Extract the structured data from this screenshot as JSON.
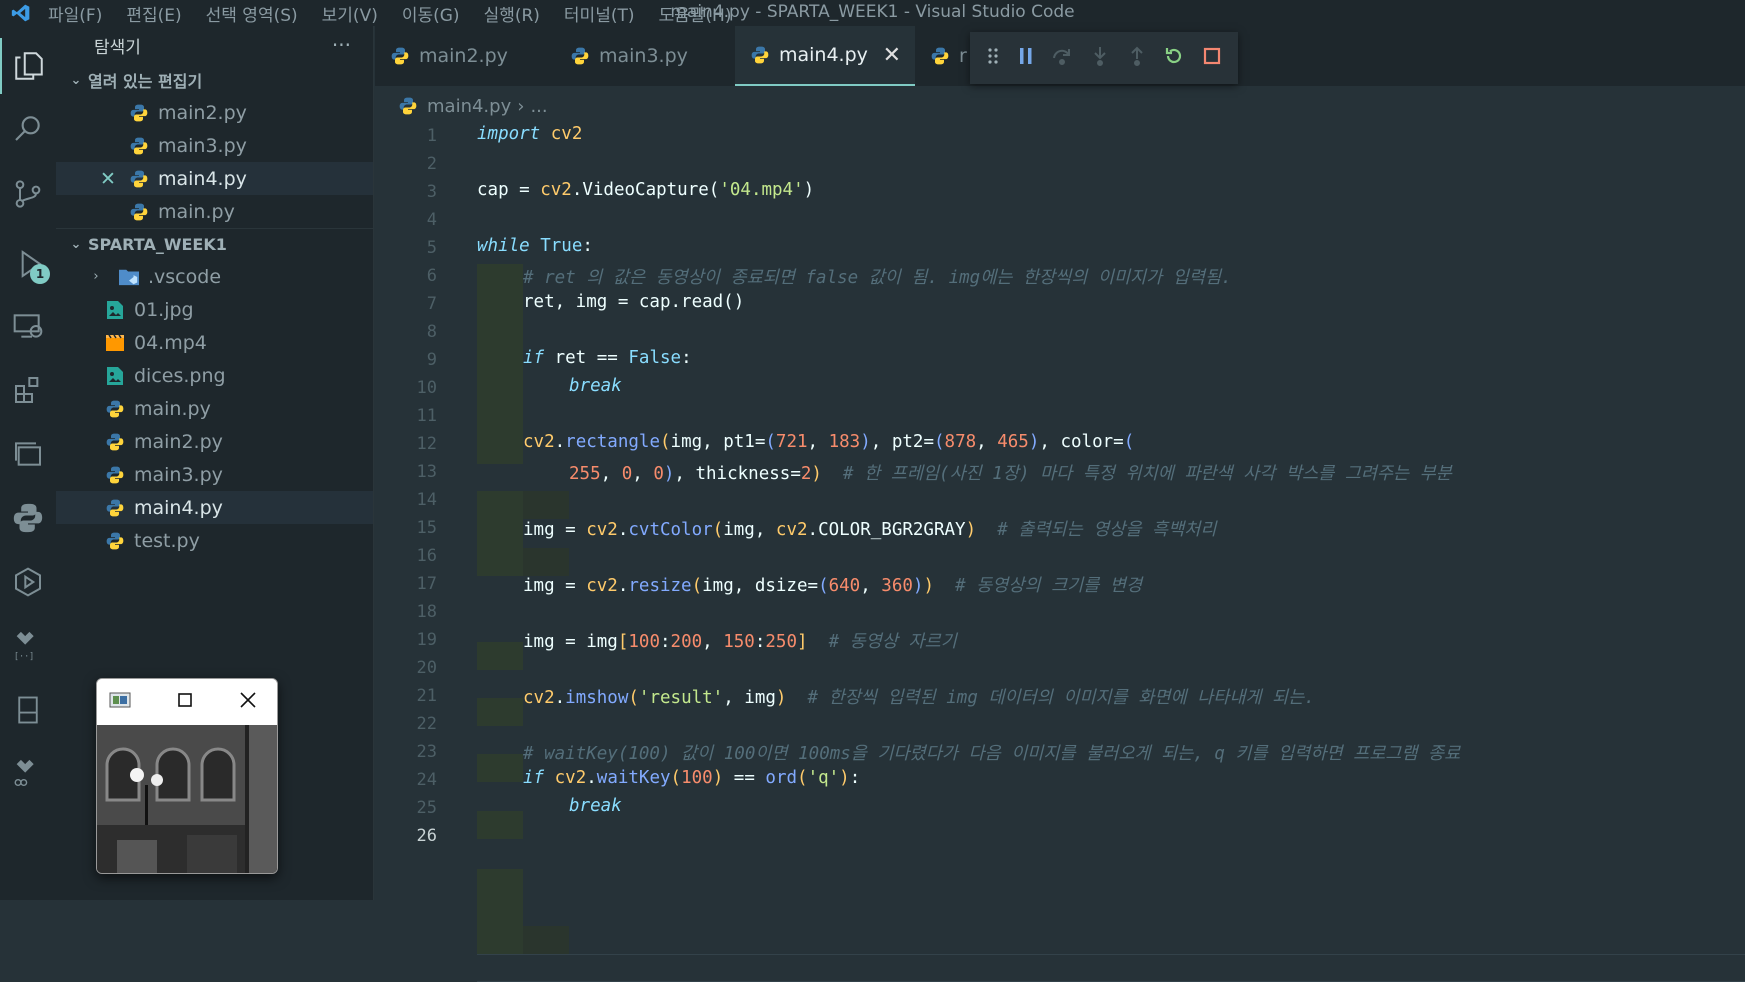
{
  "menu": [
    "파일(F)",
    "편집(E)",
    "선택 영역(S)",
    "보기(V)",
    "이동(G)",
    "실행(R)",
    "터미널(T)",
    "도움말(H)"
  ],
  "window_title": "main4.py - SPARTA_WEEK1 - Visual Studio Code",
  "activity_badge": "1",
  "sidebar": {
    "title": "탐색기",
    "more": "···",
    "open_editors_title": "열려 있는 편집기",
    "open_editors": [
      {
        "name": "main2.py"
      },
      {
        "name": "main3.py"
      },
      {
        "name": "main4.py",
        "close": "✕"
      },
      {
        "name": "main.py"
      }
    ],
    "workspace_title": "SPARTA_WEEK1",
    "files": [
      {
        "name": ".vscode",
        "kind": "folder"
      },
      {
        "name": "01.jpg",
        "kind": "image"
      },
      {
        "name": "04.mp4",
        "kind": "video"
      },
      {
        "name": "dices.png",
        "kind": "image"
      },
      {
        "name": "main.py",
        "kind": "py"
      },
      {
        "name": "main2.py",
        "kind": "py"
      },
      {
        "name": "main3.py",
        "kind": "py"
      },
      {
        "name": "main4.py",
        "kind": "py"
      },
      {
        "name": "test.py",
        "kind": "py"
      }
    ]
  },
  "tabs": [
    {
      "label": "main2.py"
    },
    {
      "label": "main3.py"
    },
    {
      "label": "main4.py",
      "close": "✕"
    },
    {
      "label": "r"
    }
  ],
  "breadcrumb": {
    "file": "main4.py",
    "sep": "›",
    "rest": "..."
  },
  "code_lines": [
    "1",
    "2",
    "3",
    "4",
    "5",
    "6",
    "7",
    "8",
    "9",
    "10",
    "11",
    "12",
    "13",
    "14",
    "15",
    "16",
    "17",
    "18",
    "19",
    "20",
    "21",
    "22",
    "23",
    "24",
    "25",
    "26"
  ],
  "code": {
    "l1_kw": "import",
    "l1_mod": "cv2",
    "l3_a": "cap = ",
    "l3_b": "cv2",
    "l3_c": ".VideoCapture(",
    "l3_s": "'04.mp4'",
    "l3_d": ")",
    "l5_kw": "while",
    "l5_b": "True",
    "l6_c": "# ret 의 값은 동영상이 종료되면 false 값이 됨. img에는 한장씩의 이미지가 입력됨.",
    "l7_a": "ret, img = cap.read()",
    "l9_kw": "if",
    "l9_a": " ret == ",
    "l9_b": "False",
    "l10_kw": "break",
    "l12_a": "cv2",
    "l12_f": "rectangle",
    "l12_b": "img",
    "l12_pt1": "pt1",
    "l12_n1": "721",
    "l12_n2": "183",
    "l12_pt2": "pt2",
    "l12_n3": "878",
    "l12_n4": "465",
    "l12_col": "color",
    "l13_n1": "255",
    "l13_n2": "0",
    "l13_n3": "0",
    "l13_th": "thickness",
    "l13_n4": "2",
    "l13_c": "# 한 프레임(사진 1장) 마다 특정 위치에 파란색 사각 박스를 그려주는 부분",
    "l15_a": "img = ",
    "l15_m": "cv2",
    "l15_f": "cvtColor",
    "l15_b": "img",
    "l15_m2": "cv2",
    "l15_k": "COLOR_BGR2GRAY",
    "l15_c": "# 출력되는 영상을 흑백처리",
    "l17_a": "img = ",
    "l17_m": "cv2",
    "l17_f": "resize",
    "l17_b": "img",
    "l17_d": "dsize",
    "l17_n1": "640",
    "l17_n2": "360",
    "l17_c": "# 동영상의 크기를 변경",
    "l19_a": "img = img",
    "l19_n1": "100",
    "l19_n2": "200",
    "l19_n3": "150",
    "l19_n4": "250",
    "l19_c": "# 동영상 자르기",
    "l21_m": "cv2",
    "l21_f": "imshow",
    "l21_s": "'result'",
    "l21_b": "img",
    "l21_c": "# 한장씩 입력된 img 데이터의 이미지를 화면에 나타내게 되는.",
    "l23_c": "# waitKey(100) 값이 100이면 100ms을 기다렸다가 다음 이미지를 불러오게 되는, q 키를 입력하면 프로그램 종료",
    "l24_kw": "if",
    "l24_m": "cv2",
    "l24_f": "waitKey",
    "l24_n": "100",
    "l24_o": "ord",
    "l24_s": "'q'",
    "l25_kw": "break"
  },
  "colors": {
    "accent": "#80cbc4",
    "bg": "#263238",
    "sidebar": "#1e272c"
  }
}
